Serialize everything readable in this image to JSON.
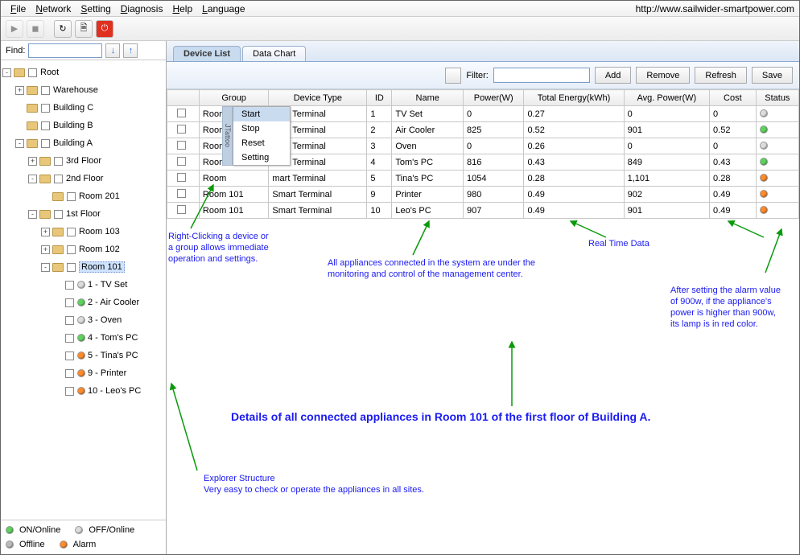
{
  "menu": {
    "file": "File",
    "network": "Network",
    "setting": "Setting",
    "diagnosis": "Diagnosis",
    "help": "Help",
    "language": "Language",
    "url": "http://www.sailwider-smartpower.com"
  },
  "find": {
    "label": "Find:"
  },
  "tree": {
    "root": "Root",
    "nodes": [
      {
        "label": "Warehouse",
        "d": 1,
        "ex": "+"
      },
      {
        "label": "Building C",
        "d": 1,
        "ex": ""
      },
      {
        "label": "Building B",
        "d": 1,
        "ex": ""
      },
      {
        "label": "Building A",
        "d": 1,
        "ex": "-"
      },
      {
        "label": "3rd Floor",
        "d": 2,
        "ex": "+"
      },
      {
        "label": "2nd Floor",
        "d": 2,
        "ex": "-"
      },
      {
        "label": "Room 201",
        "d": 3,
        "ex": ""
      },
      {
        "label": "1st Floor",
        "d": 2,
        "ex": "-"
      },
      {
        "label": "Room 103",
        "d": 3,
        "ex": "+"
      },
      {
        "label": "Room 102",
        "d": 3,
        "ex": "+"
      },
      {
        "label": "Room 101",
        "d": 3,
        "ex": "-",
        "sel": true
      },
      {
        "label": "1 - TV Set",
        "d": 4,
        "lamp": "lgr"
      },
      {
        "label": "2 - Air Cooler",
        "d": 4,
        "lamp": "lg"
      },
      {
        "label": "3 - Oven",
        "d": 4,
        "lamp": "lgr"
      },
      {
        "label": "4 - Tom's PC",
        "d": 4,
        "lamp": "lg"
      },
      {
        "label": "5 - Tina's PC",
        "d": 4,
        "lamp": "lo"
      },
      {
        "label": "9 - Printer",
        "d": 4,
        "lamp": "lo"
      },
      {
        "label": "10 - Leo's PC",
        "d": 4,
        "lamp": "lo"
      }
    ]
  },
  "legend": {
    "on": "ON/Online",
    "off": "OFF/Online",
    "offline": "Offline",
    "alarm": "Alarm"
  },
  "tabs": {
    "list": "Device List",
    "chart": "Data Chart"
  },
  "filter": {
    "label": "Filter:",
    "add": "Add",
    "remove": "Remove",
    "refresh": "Refresh",
    "save": "Save"
  },
  "cols": {
    "group": "Group",
    "type": "Device Type",
    "id": "ID",
    "name": "Name",
    "power": "Power(W)",
    "energy": "Total Energy(kWh)",
    "avg": "Avg. Power(W)",
    "cost": "Cost",
    "status": "Status"
  },
  "rows": [
    {
      "group": "Room",
      "type": "mart Terminal",
      "id": "1",
      "name": "TV Set",
      "power": "0",
      "energy": "0.27",
      "avg": "0",
      "cost": "0",
      "lamp": "lgr"
    },
    {
      "group": "Room",
      "type": "mart Terminal",
      "id": "2",
      "name": "Air Cooler",
      "power": "825",
      "energy": "0.52",
      "avg": "901",
      "cost": "0.52",
      "lamp": "lg"
    },
    {
      "group": "Room",
      "type": "mart Terminal",
      "id": "3",
      "name": "Oven",
      "power": "0",
      "energy": "0.26",
      "avg": "0",
      "cost": "0",
      "lamp": "lgr"
    },
    {
      "group": "Room",
      "type": "mart Terminal",
      "id": "4",
      "name": "Tom's PC",
      "power": "816",
      "energy": "0.43",
      "avg": "849",
      "cost": "0.43",
      "lamp": "lg"
    },
    {
      "group": "Room",
      "type": "mart Terminal",
      "id": "5",
      "name": "Tina's PC",
      "power": "1054",
      "energy": "0.28",
      "avg": "1,101",
      "cost": "0.28",
      "lamp": "lo"
    },
    {
      "group": "Room 101",
      "type": "Smart Terminal",
      "id": "9",
      "name": "Printer",
      "power": "980",
      "energy": "0.49",
      "avg": "902",
      "cost": "0.49",
      "lamp": "lo"
    },
    {
      "group": "Room 101",
      "type": "Smart Terminal",
      "id": "10",
      "name": "Leo's PC",
      "power": "907",
      "energy": "0.49",
      "avg": "901",
      "cost": "0.49",
      "lamp": "lo"
    }
  ],
  "ctx": {
    "start": "Start",
    "stop": "Stop",
    "reset": "Reset",
    "setting": "Setting",
    "side": "JTattoo"
  },
  "ann": {
    "rightclick": "Right-Clicking a device or\na group allows immediate\noperation and settings.",
    "monitor": "All appliances connected in the system are under the\nmonitoring and control of the management center.",
    "realtime": "Real Time Data",
    "alarm": "After setting the alarm value\nof 900w, if the appliance's\npower is higher than 900w,\nits lamp is in red color.",
    "title": "Details of all connected appliances in Room 101 of the first floor of Building A.",
    "explorer": "Explorer Structure\nVery easy to check or operate the appliances in all sites."
  }
}
